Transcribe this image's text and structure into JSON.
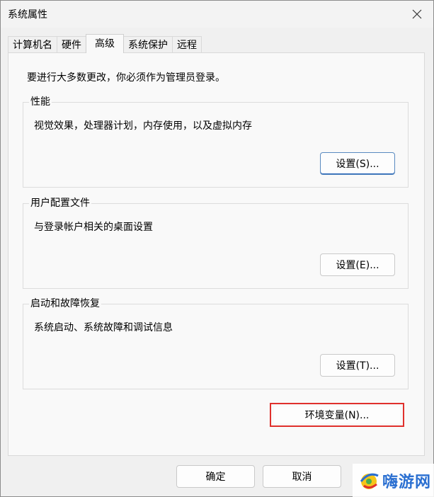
{
  "window": {
    "title": "系统属性"
  },
  "tabs": [
    "计算机名",
    "硬件",
    "高级",
    "系统保护",
    "远程"
  ],
  "active_tab": "高级",
  "admin_note": "要进行大多数更改，你必须作为管理员登录。",
  "groups": {
    "performance": {
      "title": "性能",
      "description": "视觉效果，处理器计划，内存使用，以及虚拟内存",
      "button": "设置(S)..."
    },
    "user_profiles": {
      "title": "用户配置文件",
      "description": "与登录帐户相关的桌面设置",
      "button": "设置(E)..."
    },
    "startup_recovery": {
      "title": "启动和故障恢复",
      "description": "系统启动、系统故障和调试信息",
      "button": "设置(T)..."
    }
  },
  "env_button": "环境变量(N)...",
  "footer": {
    "ok": "确定",
    "cancel": "取消"
  },
  "watermark": {
    "text": "嗨游网"
  },
  "colors": {
    "highlight": "#e0302c",
    "watermark_text": "#2a6fd1"
  }
}
